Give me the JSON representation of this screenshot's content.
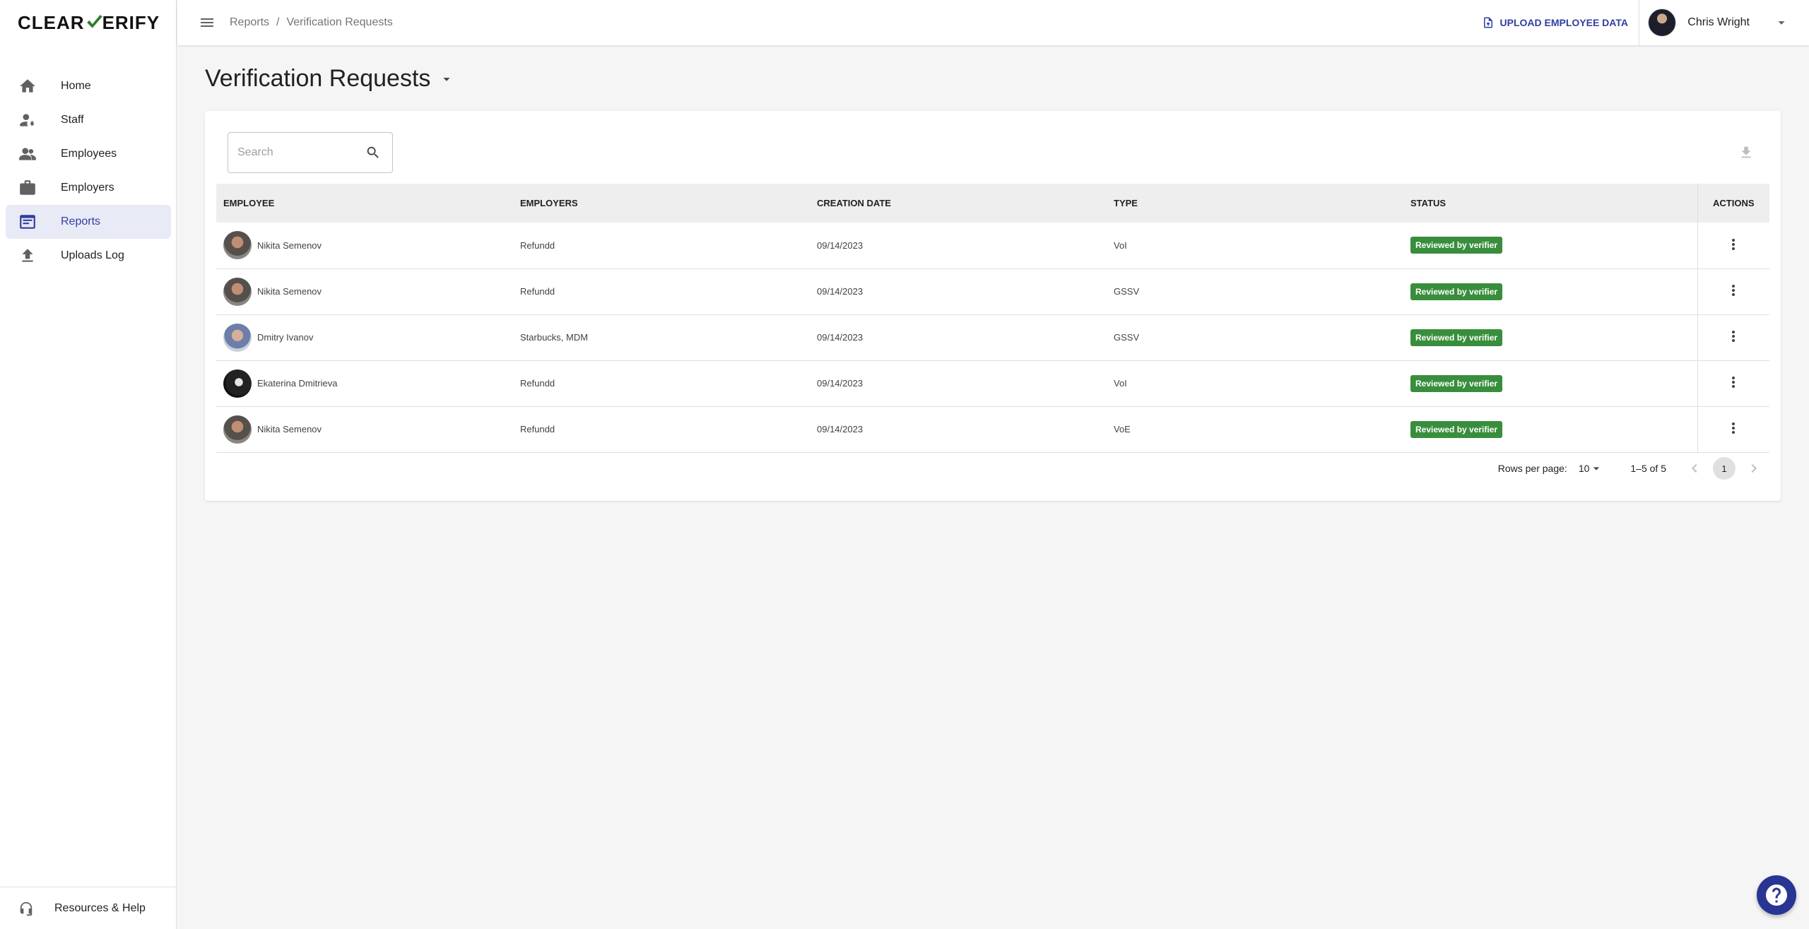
{
  "brand": {
    "name_part1": "CLEAR",
    "name_part2": "ERIFY"
  },
  "sidebar": {
    "items": [
      {
        "label": "Home",
        "icon": "home-icon"
      },
      {
        "label": "Staff",
        "icon": "staff-icon"
      },
      {
        "label": "Employees",
        "icon": "people-icon"
      },
      {
        "label": "Employers",
        "icon": "briefcase-icon"
      },
      {
        "label": "Reports",
        "icon": "report-icon",
        "active": true
      },
      {
        "label": "Uploads Log",
        "icon": "upload-icon"
      }
    ],
    "footer_label": "Resources & Help"
  },
  "topbar": {
    "breadcrumb": [
      "Reports",
      "Verification Requests"
    ],
    "breadcrumb_separator": "/",
    "upload_label": "UPLOAD EMPLOYEE DATA",
    "user_name": "Chris Wright"
  },
  "page": {
    "title": "Verification Requests"
  },
  "search": {
    "placeholder": "Search"
  },
  "table": {
    "columns": [
      "EMPLOYEE",
      "EMPLOYERS",
      "CREATION DATE",
      "TYPE",
      "STATUS",
      "ACTIONS"
    ],
    "rows": [
      {
        "employee": "Nikita Semenov",
        "employers": "Refundd",
        "date": "09/14/2023",
        "type": "VoI",
        "status": "Reviewed by verifier"
      },
      {
        "employee": "Nikita Semenov",
        "employers": "Refundd",
        "date": "09/14/2023",
        "type": "GSSV",
        "status": "Reviewed by verifier"
      },
      {
        "employee": "Dmitry Ivanov",
        "employers": "Starbucks, MDM",
        "date": "09/14/2023",
        "type": "GSSV",
        "status": "Reviewed by verifier"
      },
      {
        "employee": "Ekaterina Dmitrieva",
        "employers": "Refundd",
        "date": "09/14/2023",
        "type": "VoI",
        "status": "Reviewed by verifier"
      },
      {
        "employee": "Nikita Semenov",
        "employers": "Refundd",
        "date": "09/14/2023",
        "type": "VoE",
        "status": "Reviewed by verifier"
      }
    ]
  },
  "pagination": {
    "rows_per_page_label": "Rows per page:",
    "rows_per_page": "10",
    "range": "1–5 of 5",
    "current_page": "1"
  },
  "colors": {
    "accent": "#303f9f",
    "status_green": "#388e3c",
    "fab": "#283593"
  }
}
